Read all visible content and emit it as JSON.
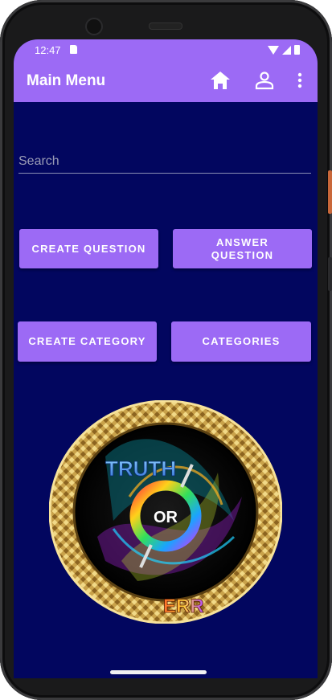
{
  "status_bar": {
    "time": "12:47"
  },
  "app_bar": {
    "title": "Main Menu",
    "icons": [
      "home-icon",
      "person-icon",
      "more-vert-icon"
    ]
  },
  "search": {
    "placeholder": "Search",
    "value": ""
  },
  "buttons": {
    "create_question": "CREATE QUESTION",
    "answer_question": "ANSWER QUESTION",
    "create_category": "CREATE CATEGORY",
    "categories": "CATEGORIES"
  },
  "logo": {
    "top": "TRUTH",
    "middle": "OR",
    "bottom": "ERR"
  },
  "colors": {
    "accent": "#9c6af5",
    "background": "#02065f",
    "gold": "#c9a24a"
  }
}
